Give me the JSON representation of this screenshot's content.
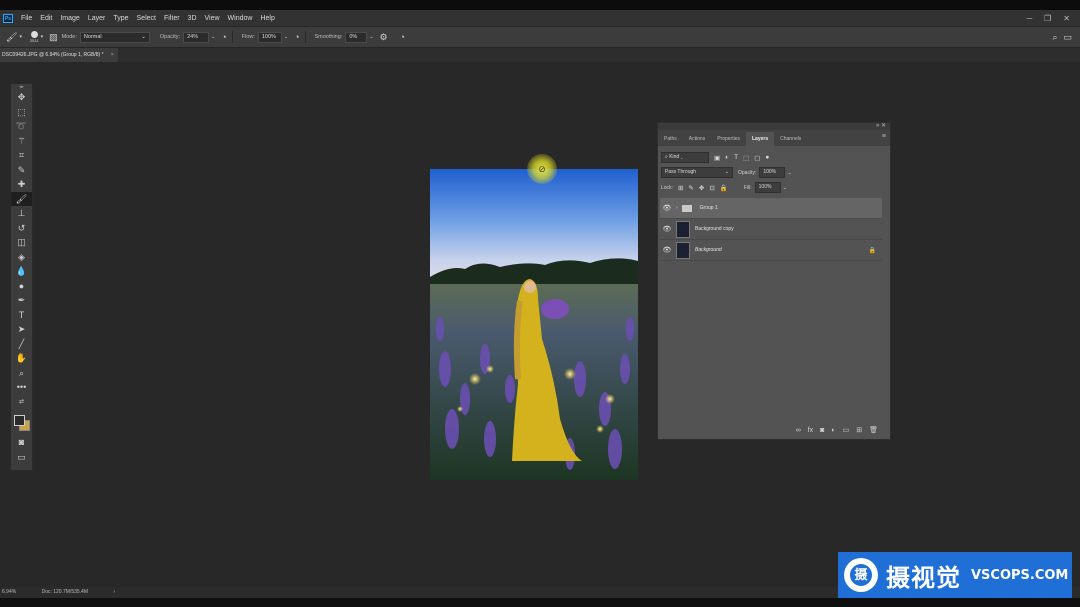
{
  "menubar": {
    "items": [
      "File",
      "Edit",
      "Image",
      "Layer",
      "Type",
      "Select",
      "Filter",
      "3D",
      "View",
      "Window",
      "Help"
    ],
    "logo_text": "Ps"
  },
  "options_bar": {
    "brush_size": "2511",
    "mode_label": "Mode:",
    "mode_value": "Normal",
    "opacity_label": "Opacity:",
    "opacity_value": "24%",
    "flow_label": "Flow:",
    "flow_value": "100%",
    "smoothing_label": "Smoothing:",
    "smoothing_value": "0%"
  },
  "document": {
    "tab_title": "DSC09426.JPG @ 6.94% (Group 1, RGB/8) *",
    "close": "×"
  },
  "layers_panel": {
    "tabs": [
      "Paths",
      "Actions",
      "Properties",
      "Layers",
      "Channels"
    ],
    "active_tab": "Layers",
    "filter_kind": "Kind",
    "blend_mode": "Pass Through",
    "opacity_label": "Opacity:",
    "opacity_value": "100%",
    "lock_label": "Lock:",
    "fill_label": "Fill:",
    "fill_value": "100%",
    "layers": [
      {
        "name": "Group 1"
      },
      {
        "name": "Background copy"
      },
      {
        "name": "Background"
      }
    ]
  },
  "statusbar": {
    "zoom": "6.94%",
    "doc_info": "Doc: 120.7M/535.4M"
  },
  "watermark": {
    "cn_text": "摄视觉",
    "en_text": "VSCOPS.COM",
    "logo_char": "摄"
  }
}
